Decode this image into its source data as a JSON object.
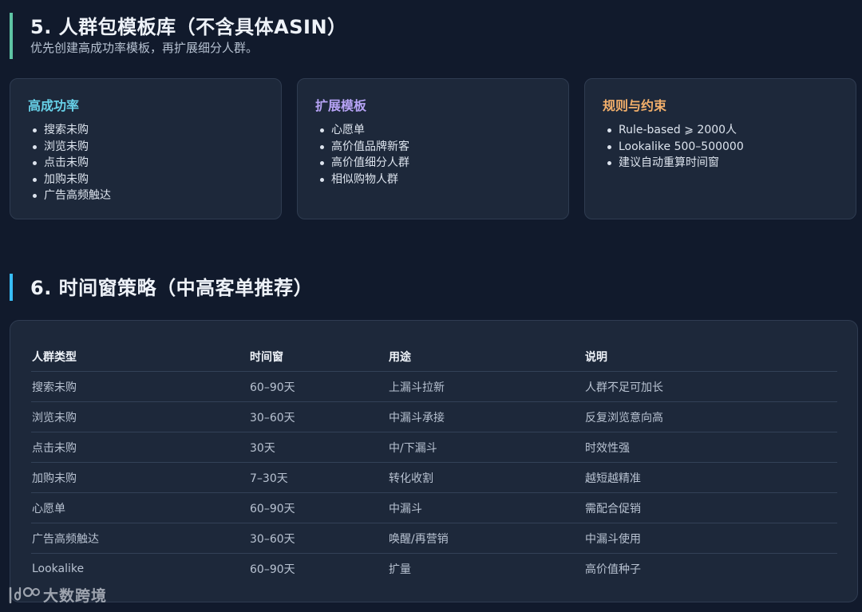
{
  "section5": {
    "title": "5. 人群包模板库（不含具体ASIN）",
    "subtitle": "优先创建高成功率模板，再扩展细分人群。"
  },
  "cards": [
    {
      "title": "高成功率",
      "items": [
        "搜索未购",
        "浏览未购",
        "点击未购",
        "加购未购",
        "广告高频触达"
      ]
    },
    {
      "title": "扩展模板",
      "items": [
        "心愿单",
        "高价值品牌新客",
        "高价值细分人群",
        "相似购物人群"
      ]
    },
    {
      "title": "规则与约束",
      "items": [
        "Rule-based ⩾ 2000人",
        "Lookalike 500–500000",
        "建议自动重算时间窗"
      ]
    }
  ],
  "section6": {
    "title": "6. 时间窗策略（中高客单推荐）"
  },
  "table": {
    "headers": [
      "人群类型",
      "时间窗",
      "用途",
      "说明"
    ],
    "rows": [
      [
        "搜索未购",
        "60–90天",
        "上漏斗拉新",
        "人群不足可加长"
      ],
      [
        "浏览未购",
        "30–60天",
        "中漏斗承接",
        "反复浏览意向高"
      ],
      [
        "点击未购",
        "30天",
        "中/下漏斗",
        "时效性强"
      ],
      [
        "加购未购",
        "7–30天",
        "转化收割",
        "越短越精准"
      ],
      [
        "心愿单",
        "60–90天",
        "中漏斗",
        "需配合促销"
      ],
      [
        "广告高频触达",
        "30–60天",
        "唤醒/再营销",
        "中漏斗使用"
      ],
      [
        "Lookalike",
        "60–90天",
        "扩量",
        "高价值种子"
      ]
    ]
  },
  "watermark": {
    "text": "大数跨境",
    "logo": "ido-logo-icon"
  },
  "colors": {
    "background": "#111a2c",
    "card": "#1d283a",
    "accent_green": "#5ec4a4",
    "accent_blue": "#38bdf8",
    "card1_title": "#67d1e8",
    "card2_title": "#b6a3f5",
    "card3_title": "#f3b06b"
  }
}
